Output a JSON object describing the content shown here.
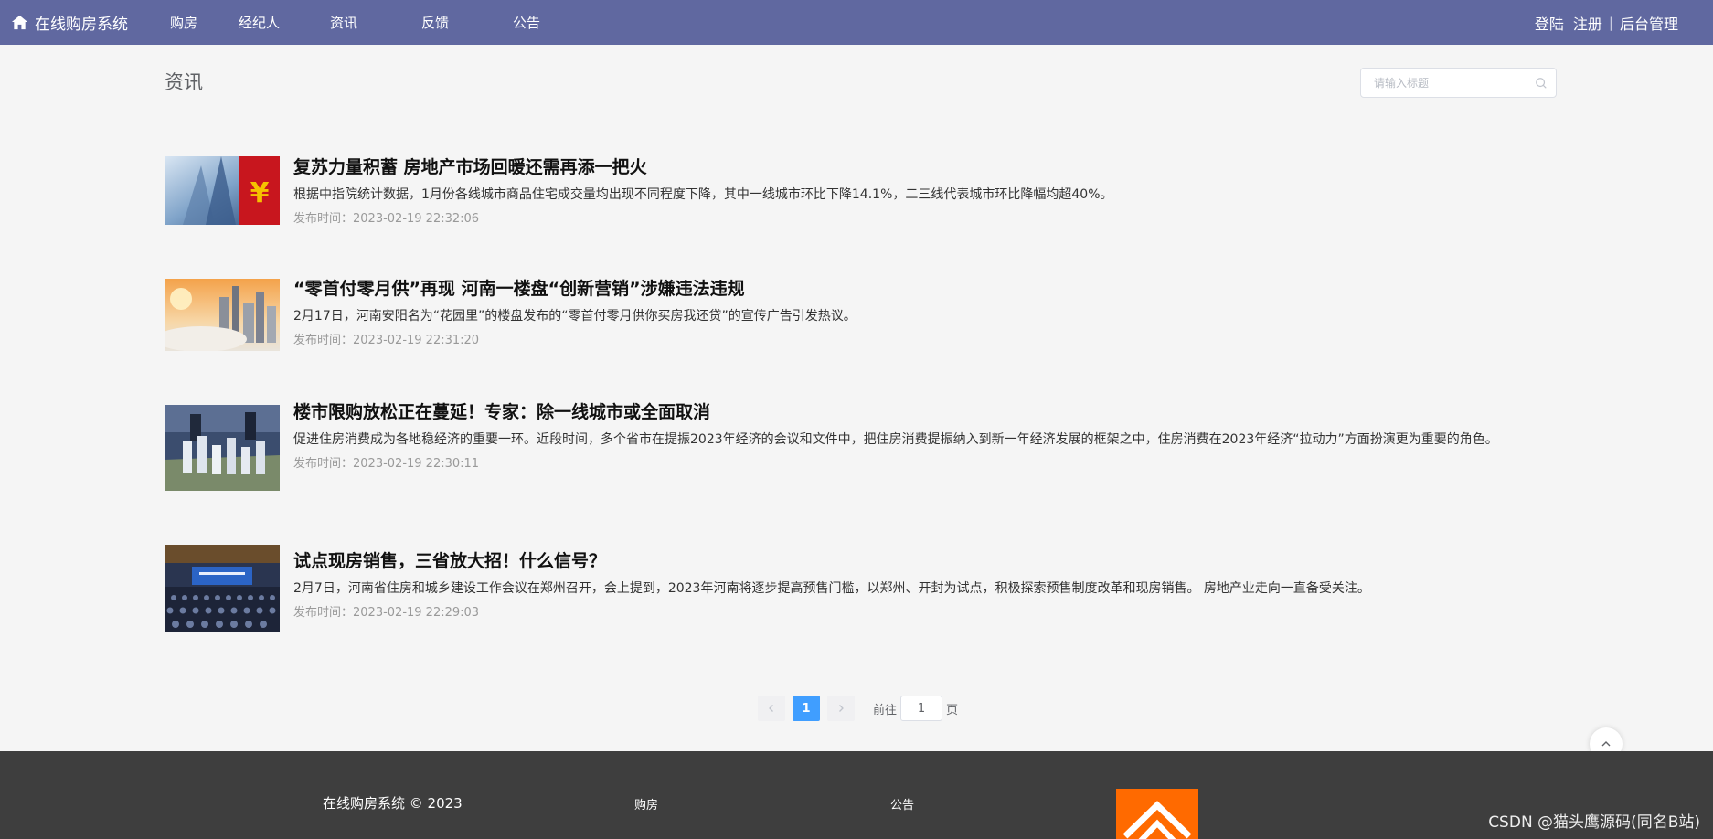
{
  "header": {
    "brand": "在线购房系统",
    "nav": [
      "购房",
      "经纪人",
      "资讯",
      "反馈",
      "公告"
    ],
    "login": "登陆",
    "register": "注册",
    "separator": "|",
    "admin": "后台管理",
    "bg_color": "#6068a0"
  },
  "section": {
    "title": "资讯",
    "search_placeholder": "请输入标题"
  },
  "news": [
    {
      "title": "复苏力量积蓄 房地产市场回暖还需再添一把火",
      "summary": "根据中指院统计数据，1月份各线城市商品住宅成交量均出现不同程度下降，其中一线城市环比下降14.1%，二三线代表城市环比降幅均超40%。",
      "time": "发布时间：2023-02-19 22:32:06",
      "thumb": "yuan-symbol-building"
    },
    {
      "title": "“零首付零月供”再现 河南一楼盘“创新营销”涉嫌违法违规",
      "summary": "2月17日，河南安阳名为“花园里”的楼盘发布的“零首付零月供你买房我还贷”的宣传广告引发热议。",
      "time": "发布时间：2023-02-19 22:31:20",
      "thumb": "city-skyline-sunset"
    },
    {
      "title": "楼市限购放松正在蔓延！专家：除一线城市或全面取消",
      "summary": "促进住房消费成为各地稳经济的重要一环。近段时间，多个省市在提振2023年经济的会议和文件中，把住房消费提振纳入到新一年经济发展的框架之中，住房消费在2023年经济“拉动力”方面扮演更为重要的角色。",
      "time": "发布时间：2023-02-19 22:30:11",
      "thumb": "housing-model"
    },
    {
      "title": "试点现房销售，三省放大招！什么信号？",
      "summary": "2月7日，河南省住房和城乡建设工作会议在郑州召开，会上提到，2023年河南将逐步提高预售门槛，以郑州、开封为试点，积极探索预售制度改革和现房销售。 房地产业走向一直备受关注。",
      "time": "发布时间：2023-02-19 22:29:03",
      "thumb": "conference-hall"
    }
  ],
  "pagination": {
    "current": "1",
    "goto_label": "前往",
    "goto_value": "1",
    "page_suffix": "页",
    "prev_icon": "chevron-left-icon",
    "next_icon": "chevron-right-icon",
    "active_color": "#409eff"
  },
  "footer": {
    "copyright": "在线购房系统 © 2023",
    "link_buy": "购房",
    "link_notice": "公告",
    "logo_color": "#ff6a00"
  },
  "watermark": "CSDN @猫头鹰源码(同名B站)"
}
